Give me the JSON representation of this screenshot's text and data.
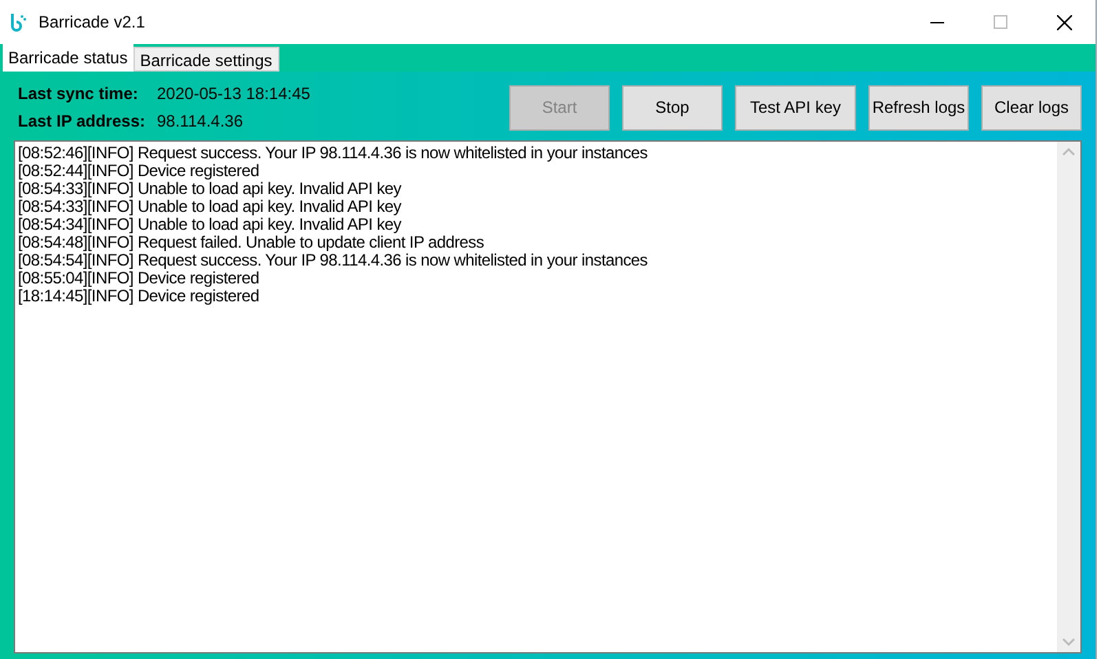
{
  "window": {
    "title": "Barricade v2.1"
  },
  "tabs": [
    {
      "label": "Barricade status",
      "selected": true
    },
    {
      "label": "Barricade settings",
      "selected": false
    }
  ],
  "status": [
    {
      "label": "Last sync time:",
      "value": "2020-05-13 18:14:45"
    },
    {
      "label": "Last IP address:",
      "value": "98.114.4.36"
    }
  ],
  "buttons": [
    {
      "label": "Start",
      "disabled": true
    },
    {
      "label": "Stop",
      "disabled": false
    },
    {
      "label": "Test API key",
      "disabled": false
    },
    {
      "label": "Refresh logs",
      "disabled": false
    },
    {
      "label": "Clear logs",
      "disabled": false
    }
  ],
  "log": [
    "[08:52:46][INFO] Request success. Your IP 98.114.4.36 is now whitelisted in your instances",
    "[08:52:44][INFO] Device registered",
    "[08:54:33][INFO] Unable to load api key. Invalid API key",
    "[08:54:33][INFO] Unable to load api key. Invalid API key",
    "[08:54:34][INFO] Unable to load api key. Invalid API key",
    "[08:54:48][INFO] Request failed. Unable to update client IP address",
    "[08:54:54][INFO] Request success. Your IP 98.114.4.36 is now whitelisted in your instances",
    "[08:55:04][INFO] Device registered",
    "[18:14:45][INFO] Device registered"
  ]
}
